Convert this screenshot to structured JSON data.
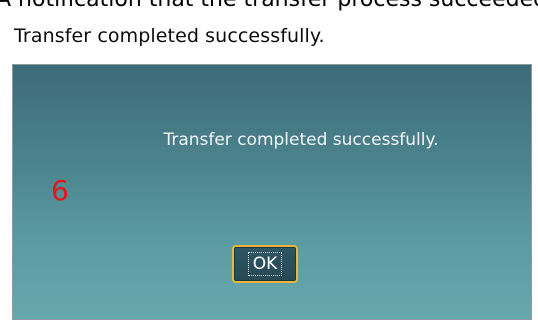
{
  "caption": "A notification that the transfer process succeeded.",
  "dialog": {
    "title": "Transfer completed successfully.",
    "message": "Transfer completed successfully.",
    "marker": "6",
    "ok_label": "OK"
  },
  "colors": {
    "panel_top": "#3c6b78",
    "panel_bottom": "#67a8ad",
    "button_border": "#e7b63a",
    "marker": "#e8141b"
  }
}
